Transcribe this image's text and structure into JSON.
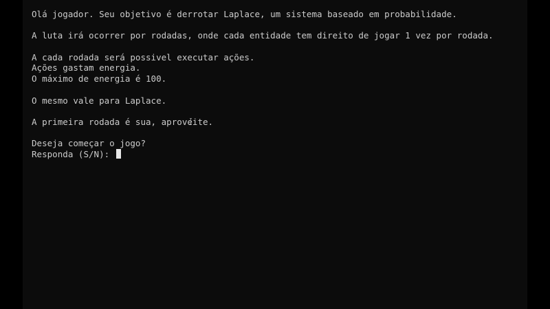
{
  "terminal": {
    "lines": [
      "Olá jogador. Seu objetivo é derrotar Laplace, um sistema baseado em probabilidade.",
      "",
      "A luta irá ocorrer por rodadas, onde cada entidade tem direito de jogar 1 vez por rodada.",
      "",
      "A cada rodada será possivel executar ações.",
      "Ações gastam energia.",
      "O máximo de energia é 100.",
      "",
      "O mesmo vale para Laplace.",
      "",
      "A primeira rodada é sua, aproveite.",
      "",
      "Deseja começar o jogo?"
    ],
    "prompt": "Responda (S/N): "
  }
}
